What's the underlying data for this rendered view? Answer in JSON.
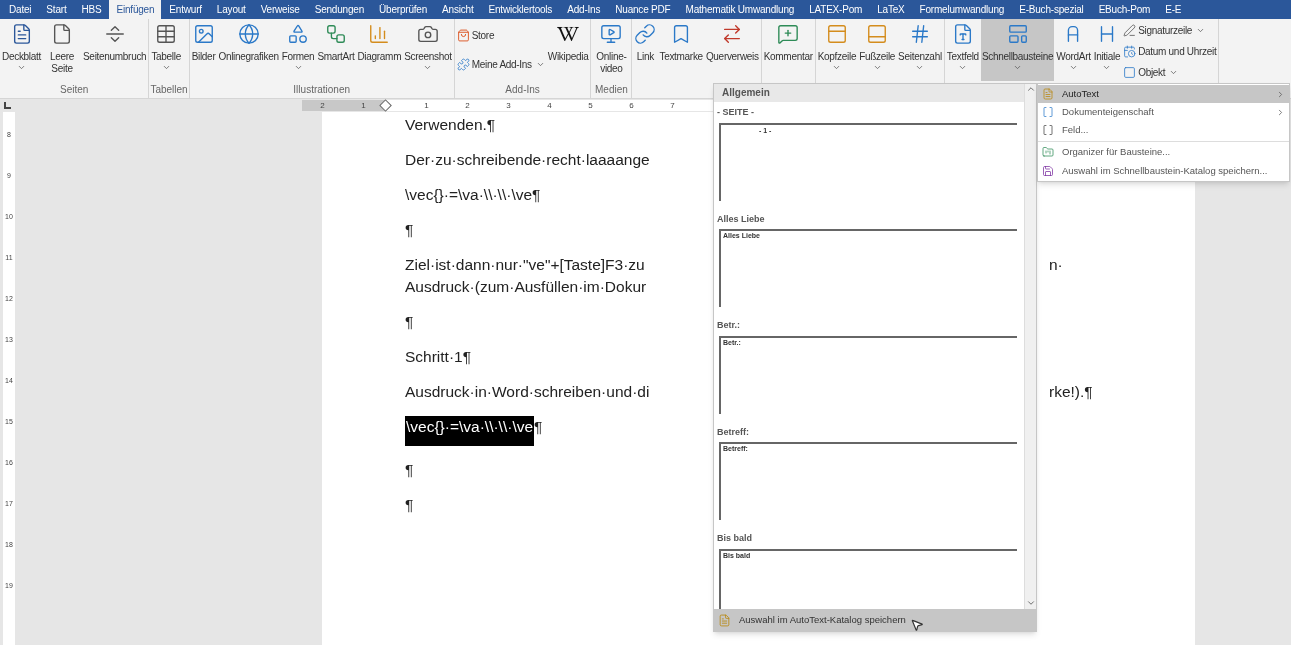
{
  "tabs": [
    {
      "label": "Datei",
      "selected": false
    },
    {
      "label": "Start",
      "selected": false
    },
    {
      "label": "HBS",
      "selected": false
    },
    {
      "label": "Einfügen",
      "selected": true
    },
    {
      "label": "Entwurf",
      "selected": false
    },
    {
      "label": "Layout",
      "selected": false
    },
    {
      "label": "Verweise",
      "selected": false
    },
    {
      "label": "Sendungen",
      "selected": false
    },
    {
      "label": "Überprüfen",
      "selected": false
    },
    {
      "label": "Ansicht",
      "selected": false
    },
    {
      "label": "Entwicklertools",
      "selected": false
    },
    {
      "label": "Add-Ins",
      "selected": false
    },
    {
      "label": "Nuance PDF",
      "selected": false
    },
    {
      "label": "Mathematik Umwandlung",
      "selected": false
    },
    {
      "label": "LATEX-Pom",
      "selected": false
    },
    {
      "label": "LaTeX",
      "selected": false
    },
    {
      "label": "Formelumwandlung",
      "selected": false
    },
    {
      "label": "E-Buch-spezial",
      "selected": false
    },
    {
      "label": "EBuch-Pom",
      "selected": false
    },
    {
      "label": "E-E",
      "selected": false
    }
  ],
  "ribbon": [
    {
      "label": "Seiten",
      "items": [
        {
          "kind": "large",
          "label": "Deckblatt",
          "dropdown": true,
          "selected": false
        },
        {
          "kind": "large",
          "label": "Leere Seite",
          "dropdown": false,
          "selected": false
        },
        {
          "kind": "large",
          "label": "Seitenumbruch",
          "dropdown": false,
          "selected": false
        }
      ]
    },
    {
      "label": "Tabellen",
      "items": [
        {
          "kind": "large",
          "label": "Tabelle",
          "dropdown": true,
          "selected": false
        }
      ]
    },
    {
      "label": "Illustrationen",
      "items": [
        {
          "kind": "large",
          "label": "Bilder",
          "dropdown": false,
          "selected": false
        },
        {
          "kind": "large",
          "label": "Onlinegrafiken",
          "dropdown": false,
          "selected": false
        },
        {
          "kind": "large",
          "label": "Formen",
          "dropdown": true,
          "selected": false
        },
        {
          "kind": "large",
          "label": "SmartArt",
          "dropdown": false,
          "selected": false
        },
        {
          "kind": "large",
          "label": "Diagramm",
          "dropdown": false,
          "selected": false
        },
        {
          "kind": "large",
          "label": "Screenshot",
          "dropdown": true,
          "selected": false
        }
      ]
    },
    {
      "label": "Add-Ins",
      "items": [
        {
          "kind": "small",
          "label": "Store",
          "dropdown": false,
          "selected": false
        },
        {
          "kind": "small",
          "label": "Meine Add-Ins",
          "dropdown": true,
          "selected": false
        },
        {
          "kind": "large",
          "label": "Wikipedia",
          "dropdown": false,
          "selected": false
        }
      ]
    },
    {
      "label": "Medien",
      "items": [
        {
          "kind": "large",
          "label": "Online-video",
          "dropdown": false,
          "selected": false
        }
      ]
    },
    {
      "items": [
        {
          "kind": "large",
          "label": "Link",
          "dropdown": false,
          "selected": false
        },
        {
          "kind": "large",
          "label": "Textmarke",
          "dropdown": false,
          "selected": false
        },
        {
          "kind": "large",
          "label": "Querverweis",
          "dropdown": false,
          "selected": false
        }
      ]
    },
    {
      "items": [
        {
          "kind": "large",
          "label": "Kommentar",
          "dropdown": false,
          "selected": false
        }
      ]
    },
    {
      "items": [
        {
          "kind": "large",
          "label": "Kopfzeile",
          "dropdown": true,
          "selected": false
        },
        {
          "kind": "large",
          "label": "Fußzeile",
          "dropdown": true,
          "selected": false
        },
        {
          "kind": "large",
          "label": "Seitenzahl",
          "dropdown": true,
          "selected": false
        }
      ]
    },
    {
      "items": [
        {
          "kind": "large",
          "label": "Textfeld",
          "dropdown": true,
          "selected": false
        },
        {
          "kind": "large",
          "label": "Schnellbausteine",
          "dropdown": true,
          "selected": true
        },
        {
          "kind": "large",
          "label": "WordArt",
          "dropdown": true,
          "selected": false
        },
        {
          "kind": "large",
          "label": "Initiale",
          "dropdown": true,
          "selected": false
        },
        {
          "kind": "small",
          "label": "Signaturzeile",
          "dropdown": true,
          "selected": false
        },
        {
          "kind": "small",
          "label": "Datum und Uhrzeit",
          "dropdown": false,
          "selected": false
        },
        {
          "kind": "small",
          "label": "Objekt",
          "dropdown": true,
          "selected": false
        }
      ]
    }
  ],
  "ruler": {
    "left_numbers": [
      "2",
      "1"
    ],
    "right_numbers": [
      "1",
      "2",
      "3",
      "4",
      "5",
      "6",
      "7"
    ],
    "vertical_numbers": [
      "8",
      "9",
      "10",
      "11",
      "12",
      "13",
      "14",
      "15",
      "16",
      "17",
      "18",
      "19"
    ]
  },
  "document": [
    {
      "kind": "paragraph",
      "text": "Verwenden.¶",
      "selected": false
    },
    {
      "kind": "paragraph",
      "text": "Der·zu·schreibende·recht·laaaange",
      "selected": false
    },
    {
      "kind": "paragraph",
      "text": "\\vec{}·=\\va·\\\\·\\\\·\\ve¶",
      "selected": false
    },
    {
      "kind": "paragraph",
      "text": "¶",
      "selected": false
    },
    {
      "kind": "paragraph",
      "text": "Ziel·ist·dann·nur·\"ve\"+[Taste]F3·zu",
      "right": "n·",
      "selected": false
    },
    {
      "kind": "continuation",
      "text": "Ausdruck·(zum·Ausfüllen·im·Dokur",
      "selected": false
    },
    {
      "kind": "paragraph",
      "text": "¶",
      "selected": false
    },
    {
      "kind": "paragraph",
      "text": "Schritt·1¶",
      "selected": false
    },
    {
      "kind": "paragraph",
      "text": "Ausdruck·in·Word·schreiben·und·di",
      "right": "rke!).¶",
      "selected": false
    },
    {
      "kind": "paragraph",
      "text": "\\vec{}·=\\va·\\\\·\\\\·\\ve",
      "tail": "¶",
      "selected": true
    },
    {
      "kind": "paragraph",
      "text": "¶",
      "selected": false
    },
    {
      "kind": "paragraph",
      "text": "¶",
      "selected": false
    }
  ],
  "gallery": {
    "header": "Allgemein",
    "sections": [
      {
        "title": "- SEITE -",
        "preview": "- 1 -"
      },
      {
        "title": "Alles Liebe",
        "preview": "Alles Liebe"
      },
      {
        "title": "Betr.:",
        "preview": "Betr.:"
      },
      {
        "title": "Betreff:",
        "preview": "Betreff:"
      },
      {
        "title": "Bis bald",
        "preview": "Bis bald"
      }
    ],
    "footer": {
      "label": "Auswahl im AutoText-Katalog speichern",
      "selected": true
    }
  },
  "submenu": [
    {
      "label": "AutoText",
      "arrow": true,
      "selected": true,
      "divider_before": false
    },
    {
      "label": "Dokumenteigenschaft",
      "arrow": true,
      "selected": false,
      "divider_before": false
    },
    {
      "label": "Feld...",
      "arrow": false,
      "selected": false,
      "divider_before": false
    },
    {
      "label": "Organizer für Bausteine...",
      "arrow": false,
      "selected": false,
      "divider_before": true
    },
    {
      "label": "Auswahl im Schnellbaustein-Katalog speichern...",
      "arrow": false,
      "selected": false,
      "divider_before": false
    }
  ]
}
